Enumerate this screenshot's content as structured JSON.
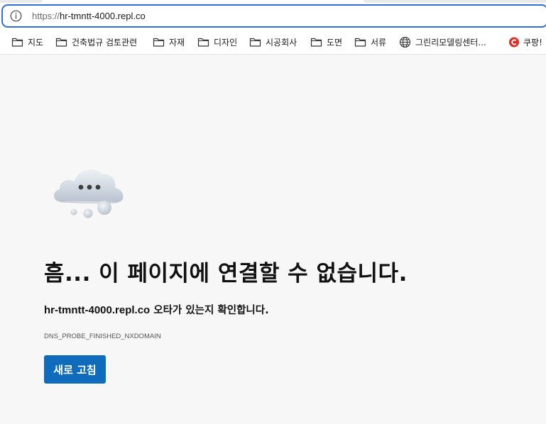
{
  "address_bar": {
    "scheme": "https://",
    "host": "hr-tmntt-4000.repl.co",
    "info_icon": "info-icon"
  },
  "bookmarks": [
    {
      "label": "지도",
      "icon": "folder-icon"
    },
    {
      "label": "건축법규 검토관련",
      "icon": "folder-icon"
    },
    {
      "label": "자재",
      "icon": "folder-icon"
    },
    {
      "label": "디자인",
      "icon": "folder-icon"
    },
    {
      "label": "시공회사",
      "icon": "folder-icon"
    },
    {
      "label": "도면",
      "icon": "folder-icon"
    },
    {
      "label": "서류",
      "icon": "folder-icon"
    },
    {
      "label": "그린리모델링센터...",
      "icon": "globe-icon"
    },
    {
      "label": "쿠팡!",
      "icon": "coupang-icon"
    }
  ],
  "error_page": {
    "illustration": "cloud-icon",
    "title": "흠... 이 페이지에 연결할 수 없습니다.",
    "message_host": "hr-tmntt-4000.repl.co",
    "message_rest": " 오타가 있는지 확인합니다.",
    "error_code": "DNS_PROBE_FINISHED_NXDOMAIN",
    "reload_label": "새로 고침"
  },
  "colors": {
    "accent": "#0f6cbd",
    "address_focus": "#2f6fd6",
    "page_bg": "#f7f7f7",
    "coupang_red": "#d9342b"
  }
}
